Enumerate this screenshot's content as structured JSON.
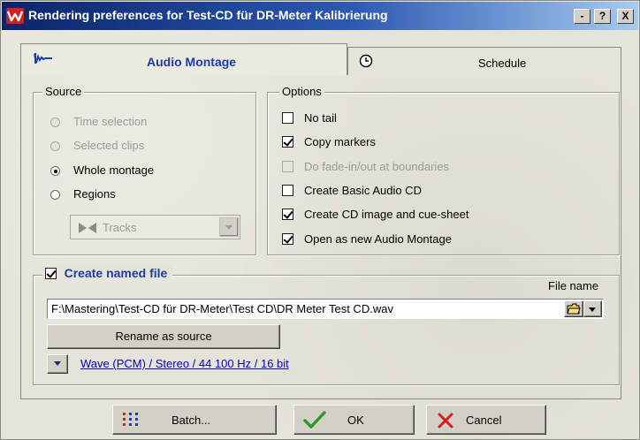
{
  "window": {
    "title": "Rendering preferences for Test-CD für DR-Meter Kalibrierung",
    "controls": {
      "minimize": "-",
      "help": "?",
      "close": "X"
    }
  },
  "tabs": [
    {
      "label": "Audio Montage",
      "icon": "waveform-icon",
      "active": true
    },
    {
      "label": "Schedule",
      "icon": "clock-icon",
      "active": false
    }
  ],
  "source": {
    "title": "Source",
    "options": [
      {
        "label": "Time selection",
        "enabled": false,
        "selected": false
      },
      {
        "label": "Selected clips",
        "enabled": false,
        "selected": false
      },
      {
        "label": "Whole montage",
        "enabled": true,
        "selected": true
      },
      {
        "label": "Regions",
        "enabled": true,
        "selected": false
      }
    ],
    "regions_select": {
      "value": "Tracks",
      "icon": "bowtie-icon",
      "enabled": false
    }
  },
  "options": {
    "title": "Options",
    "items": [
      {
        "label": "No tail",
        "checked": false,
        "enabled": true
      },
      {
        "label": "Copy markers",
        "checked": true,
        "enabled": true
      },
      {
        "label": "Do fade-in/out at boundaries",
        "checked": false,
        "enabled": false
      },
      {
        "label": "Create Basic Audio CD",
        "checked": false,
        "enabled": true
      },
      {
        "label": "Create CD image and cue-sheet",
        "checked": true,
        "enabled": true
      },
      {
        "label": "Open as new Audio Montage",
        "checked": true,
        "enabled": true
      }
    ]
  },
  "named_file": {
    "label": "Create named file",
    "checked": true,
    "file_name_label": "File name",
    "path": "F:\\Mastering\\Test-CD für DR-Meter\\Test CD\\DR Meter Test CD.wav",
    "rename_button": "Rename as source",
    "format_link": "Wave (PCM) / Stereo / 44 100 Hz / 16 bit"
  },
  "footer": {
    "batch": "Batch...",
    "ok": "OK",
    "cancel": "Cancel"
  },
  "colors": {
    "title_gradient_start": "#0a246a",
    "title_gradient_end": "#a6caf0",
    "link": "#0000cc",
    "named_file_label": "#1a3fa8",
    "ok_check": "#2a9a2a",
    "cancel_x": "#d41f1f"
  }
}
